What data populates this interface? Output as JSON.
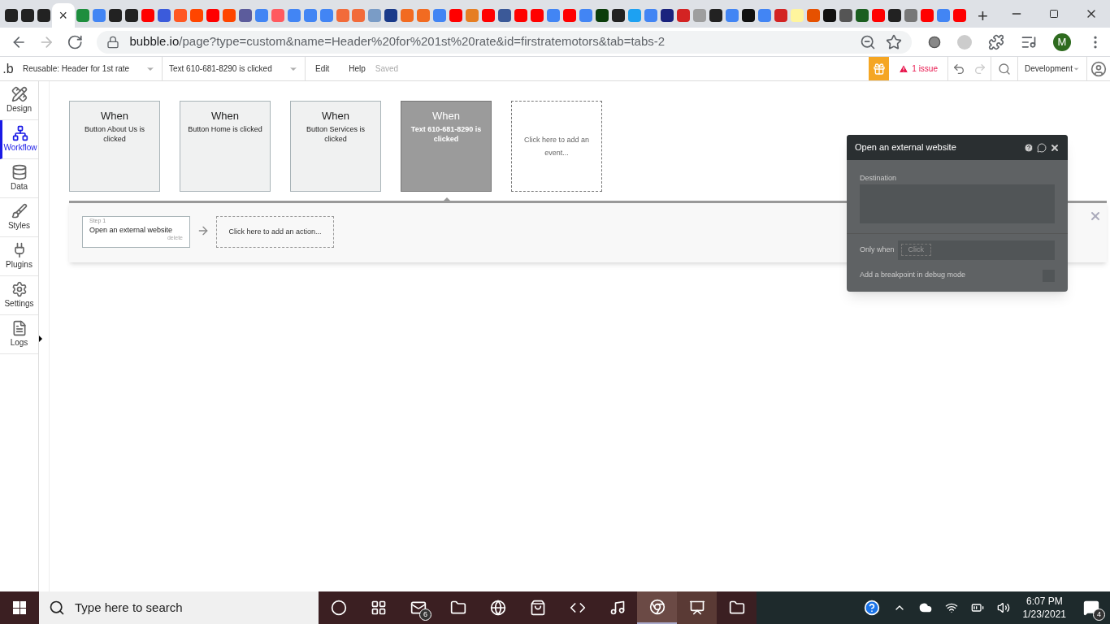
{
  "browser_tabs": [
    {
      "color": "#222222",
      "selected": false
    },
    {
      "color": "#222222",
      "selected": false
    },
    {
      "color": "#222222",
      "selected": false
    },
    {
      "selected": true,
      "close_label": "×"
    },
    {
      "color": "#1e8e3e",
      "selected": false
    },
    {
      "color": "#4285f4",
      "selected": false
    },
    {
      "color": "#222222",
      "selected": false
    },
    {
      "color": "#222222",
      "selected": false
    },
    {
      "color": "#ff0000",
      "selected": false
    },
    {
      "color": "#3b5bdb",
      "selected": false
    },
    {
      "color": "#ff5722",
      "selected": false
    },
    {
      "color": "#ff4500",
      "selected": false
    },
    {
      "color": "#ff0000",
      "selected": false
    },
    {
      "color": "#ff4500",
      "selected": false
    },
    {
      "color": "#5c5c9c",
      "selected": false
    },
    {
      "color": "#4285f4",
      "selected": false
    },
    {
      "color": "#ff5a5f",
      "selected": false
    },
    {
      "color": "#4285f4",
      "selected": false
    },
    {
      "color": "#4285f4",
      "selected": false
    },
    {
      "color": "#4285f4",
      "selected": false
    },
    {
      "color": "#f26b3a",
      "selected": false
    },
    {
      "color": "#f26b3a",
      "selected": false
    },
    {
      "color": "#7a9cc6",
      "selected": false
    },
    {
      "color": "#1a3a8a",
      "selected": false
    },
    {
      "color": "#f26b21",
      "selected": false
    },
    {
      "color": "#f26b21",
      "selected": false
    },
    {
      "color": "#4285f4",
      "selected": false
    },
    {
      "color": "#ff0000",
      "selected": false
    },
    {
      "color": "#e67e22",
      "selected": false
    },
    {
      "color": "#ff0000",
      "selected": false
    },
    {
      "color": "#3b5998",
      "selected": false
    },
    {
      "color": "#ff0000",
      "selected": false
    },
    {
      "color": "#ff0000",
      "selected": false
    },
    {
      "color": "#4285f4",
      "selected": false
    },
    {
      "color": "#ff0000",
      "selected": false
    },
    {
      "color": "#4285f4",
      "selected": false
    },
    {
      "color": "#0b3d0b",
      "selected": false
    },
    {
      "color": "#222222",
      "selected": false
    },
    {
      "color": "#1da1f2",
      "selected": false
    },
    {
      "color": "#4285f4",
      "selected": false
    },
    {
      "color": "#1a237e",
      "selected": false
    },
    {
      "color": "#d32323",
      "selected": false
    },
    {
      "color": "#9e9e9e",
      "selected": false
    },
    {
      "color": "#222222",
      "selected": false
    },
    {
      "color": "#4285f4",
      "selected": false
    },
    {
      "color": "#111111",
      "selected": false
    },
    {
      "color": "#4285f4",
      "selected": false
    },
    {
      "color": "#d32323",
      "selected": false
    },
    {
      "color": "#fff59d",
      "selected": false
    },
    {
      "color": "#e65100",
      "selected": false
    },
    {
      "color": "#111111",
      "selected": false
    },
    {
      "color": "#555555",
      "selected": false
    },
    {
      "color": "#1b5e20",
      "selected": false
    },
    {
      "color": "#ff0000",
      "selected": false
    },
    {
      "color": "#222222",
      "selected": false
    },
    {
      "color": "#777777",
      "selected": false
    },
    {
      "color": "#ff0000",
      "selected": false
    },
    {
      "color": "#4285f4",
      "selected": false
    },
    {
      "color": "#ff0000",
      "selected": false
    }
  ],
  "new_tab_label": "+",
  "address": {
    "host": "bubble.io",
    "path": "/page?type=custom&name=Header%20for%201st%20rate&id=firstratemotors&tab=tabs-2"
  },
  "profile_initial": "M",
  "editor_toolbar": {
    "logo": ".b",
    "page_select": "Reusable: Header for 1st rate",
    "workflow_select": "Text 610-681-8290 is clicked",
    "menus": [
      "Edit",
      "Help"
    ],
    "save_status": "Saved",
    "issues": "1 issue",
    "mode": "Development"
  },
  "sidebar": [
    {
      "label": "Design",
      "selected": false
    },
    {
      "label": "Workflow",
      "selected": true
    },
    {
      "label": "Data",
      "selected": false
    },
    {
      "label": "Styles",
      "selected": false
    },
    {
      "label": "Plugins",
      "selected": false
    },
    {
      "label": "Settings",
      "selected": false
    },
    {
      "label": "Logs",
      "selected": false
    }
  ],
  "events": [
    {
      "title": "When",
      "condition": "Button About Us is clicked",
      "selected": false
    },
    {
      "title": "When",
      "condition": "Button Home is clicked",
      "selected": false
    },
    {
      "title": "When",
      "condition": "Button Services is clicked",
      "selected": false
    },
    {
      "title": "When",
      "condition": "Text 610-681-8290 is clicked",
      "selected": true
    }
  ],
  "add_event": "Click here to add an event...",
  "actions": [
    {
      "step": "Step 1",
      "name": "Open an external website",
      "delete": "delete"
    }
  ],
  "add_action": "Click here to add an action...",
  "property_panel": {
    "title": "Open an external website",
    "destination_label": "Destination",
    "only_when_label": "Only when",
    "only_when_placeholder": "Click",
    "breakpoint_label": "Add a breakpoint in debug mode",
    "breakpoint_checked": false
  },
  "taskbar": {
    "search_placeholder": "Type here to search",
    "mail_badge": "6",
    "time": "6:07 PM",
    "date": "1/23/2021",
    "notifications": "4"
  }
}
